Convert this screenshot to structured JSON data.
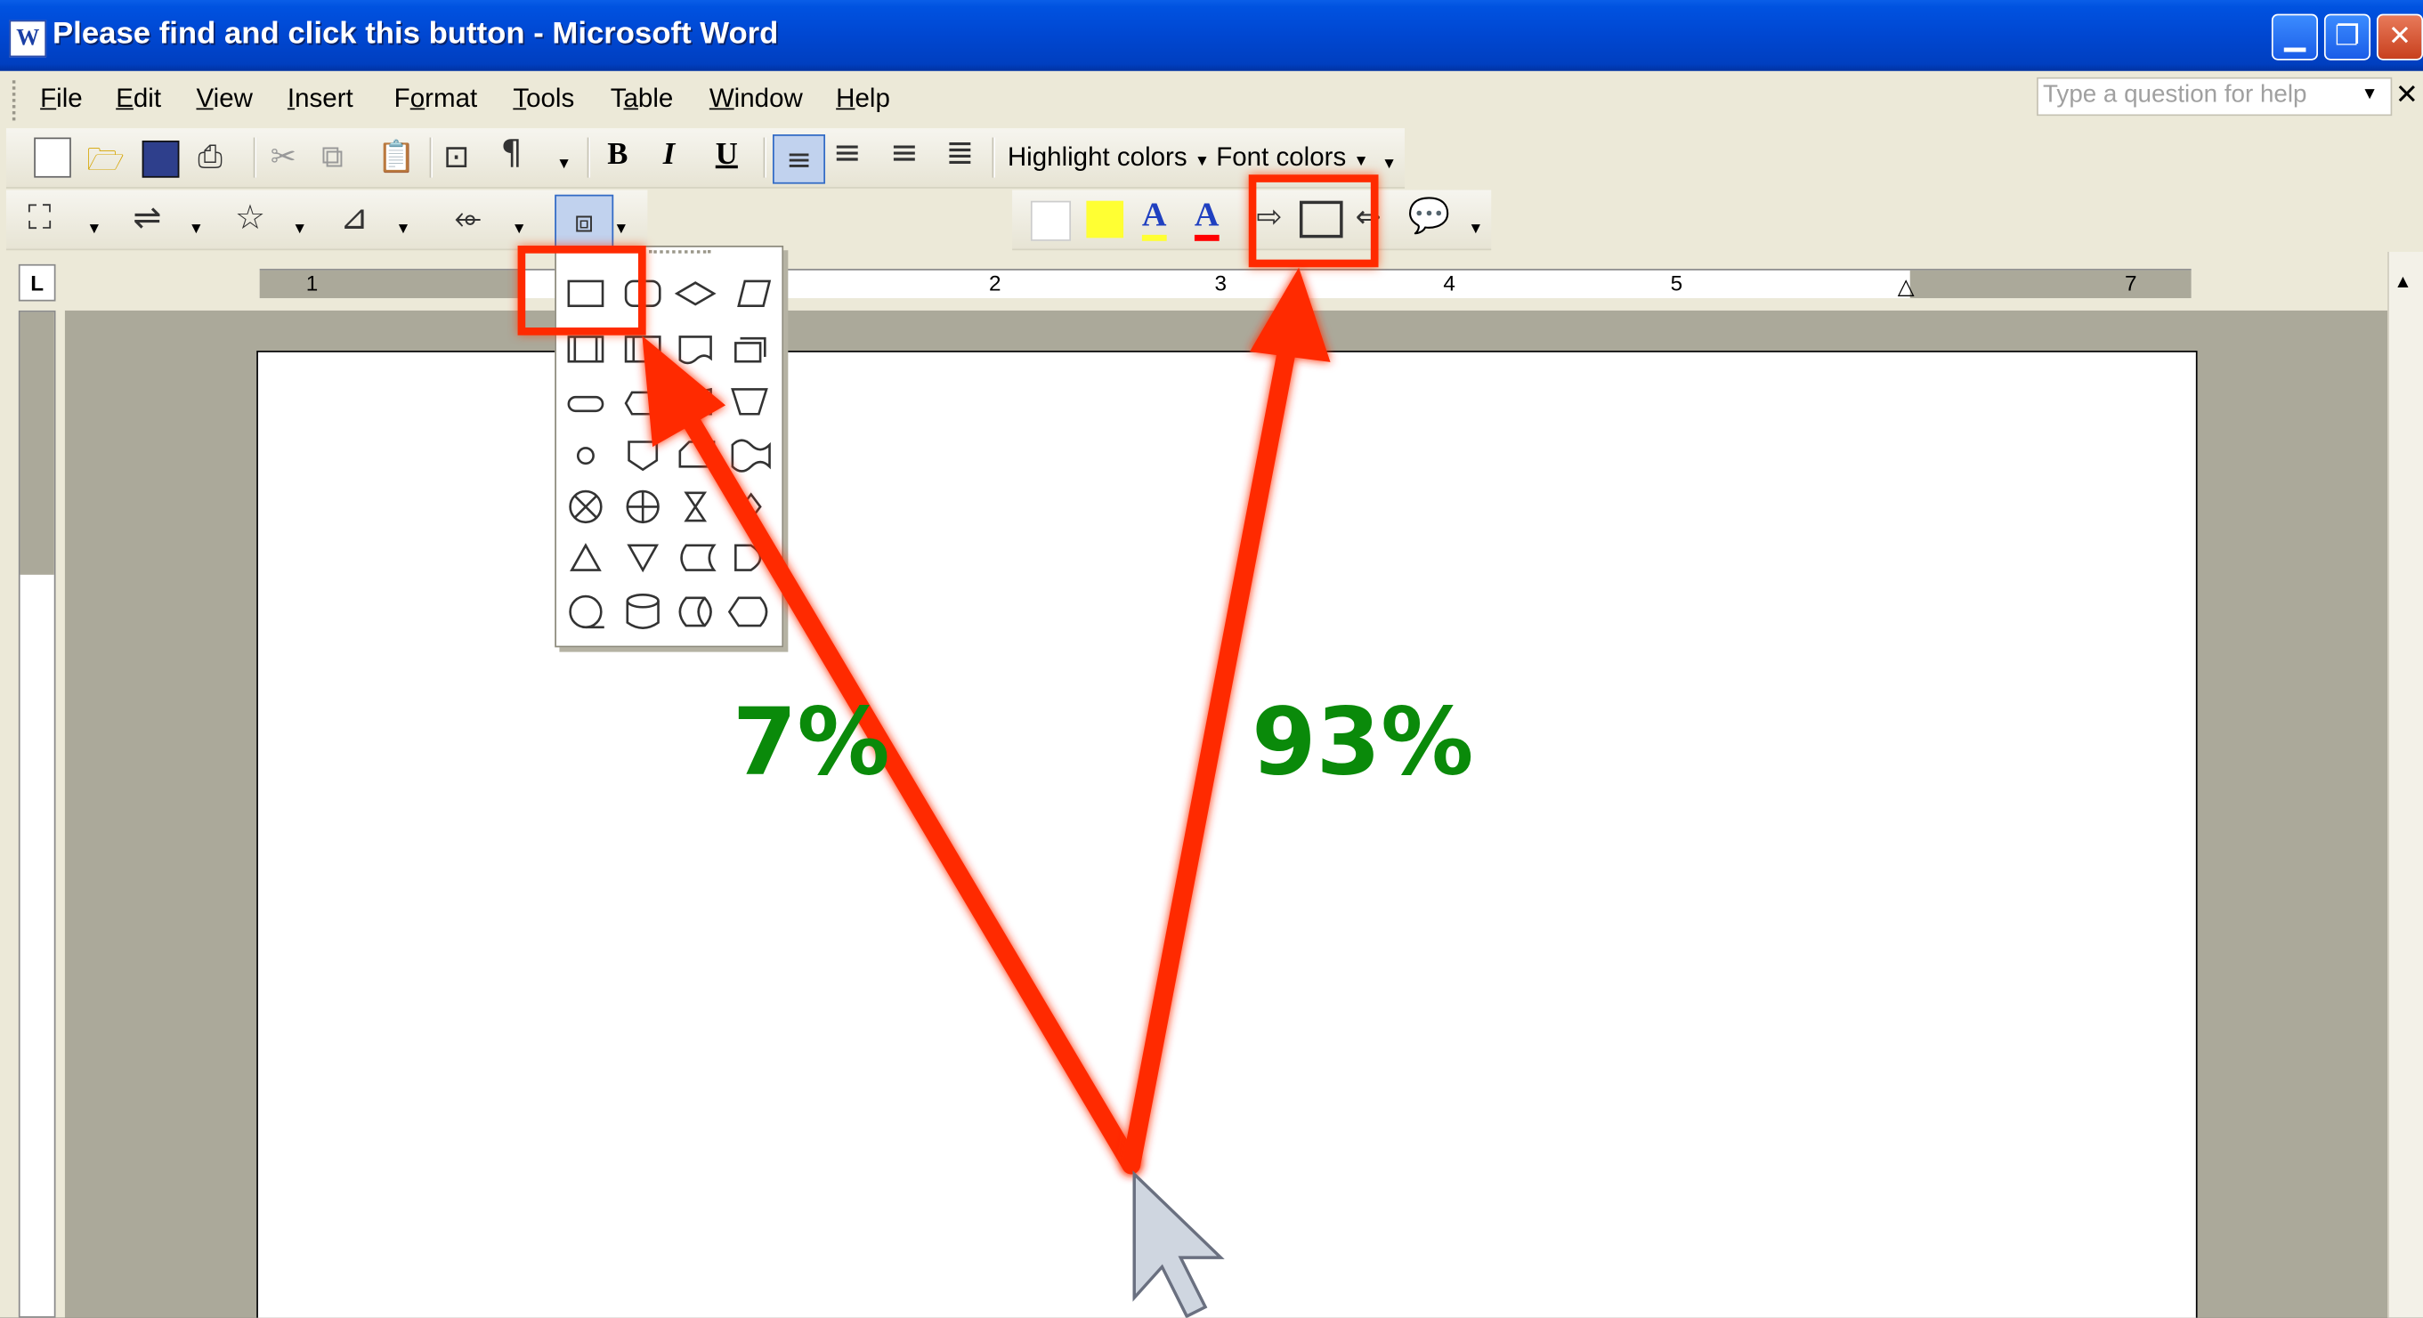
{
  "window": {
    "title": "Please find and click this button - Microsoft Word",
    "app_icon": "word-icon",
    "controls": [
      "minimize-icon",
      "restore-icon",
      "close-icon"
    ]
  },
  "menu": [
    {
      "label": "File"
    },
    {
      "label": "Edit"
    },
    {
      "label": "View"
    },
    {
      "label": "Insert"
    },
    {
      "label": "Format"
    },
    {
      "label": "Tools"
    },
    {
      "label": "Table"
    },
    {
      "label": "Window"
    },
    {
      "label": "Help"
    }
  ],
  "help_box": {
    "placeholder": "Type a question for help"
  },
  "toolbar_formatting": {
    "highlight_label": "Highlight colors",
    "font_colors_label": "Font colors"
  },
  "ruler": {
    "numbers": [
      "1",
      "2",
      "3",
      "4",
      "5",
      "7"
    ]
  },
  "annotation": {
    "left_percent": "7%",
    "right_percent": "93%",
    "arrow_color": "#ff2a00",
    "text_color": "#0a8a0a"
  }
}
